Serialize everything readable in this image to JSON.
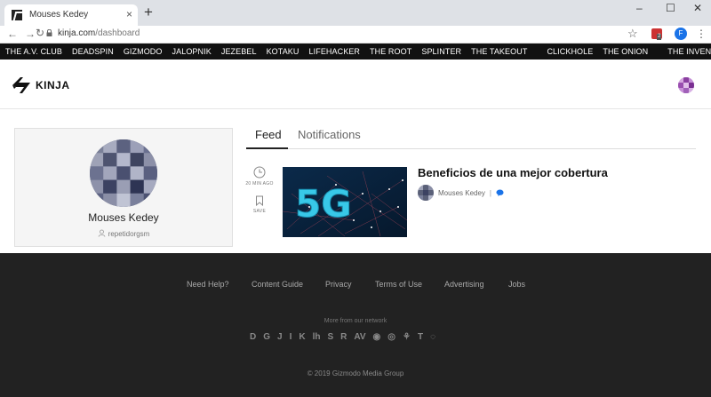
{
  "browser": {
    "tab_title": "Mouses Kedey",
    "tab_close": "×",
    "new_tab": "+",
    "window_controls": [
      "–",
      "☐",
      "✕"
    ],
    "url_host": "kinja.com",
    "url_path": "/dashboard",
    "back": "←",
    "forward": "→",
    "reload": "↻",
    "bookmark_star": "☆",
    "extension_badge": "2",
    "profile_initial": "F",
    "menu": "⋮"
  },
  "network_nav": {
    "group_sites": [
      "THE A.V. CLUB",
      "DEADSPIN",
      "GIZMODO",
      "JALOPNIK",
      "JEZEBEL",
      "KOTAKU",
      "LIFEHACKER",
      "THE ROOT",
      "SPLINTER",
      "THE TAKEOUT"
    ],
    "group_onion": [
      "CLICKHOLE",
      "THE ONION"
    ],
    "group_inventory": [
      "THE INVENTORY"
    ]
  },
  "header": {
    "logo_text": "KINJA"
  },
  "profile": {
    "name": "Mouses Kedey",
    "username": "repetidorgsm"
  },
  "feed_tabs": [
    {
      "label": "Feed",
      "active": true
    },
    {
      "label": "Notifications",
      "active": false
    }
  ],
  "post": {
    "time_ago": "20 MIN AGO",
    "save_label": "SAVE",
    "thumbnail_text": "5G",
    "title": "Beneficios de una mejor cobertura",
    "author": "Mouses Kedey",
    "separator": "|"
  },
  "footer": {
    "links": [
      "Need Help?",
      "Content Guide",
      "Privacy",
      "Terms of Use",
      "Advertising",
      "Jobs"
    ],
    "more_from_network": "More from our network",
    "brand_glyphs": [
      "D",
      "G",
      "J",
      "I",
      "K",
      "lh",
      "S",
      "R",
      "AV",
      "◉",
      "◎",
      "⚘",
      "T",
      "◌"
    ],
    "copyright": "© 2019 Gizmodo Media Group"
  },
  "colors": {
    "accent_blue": "#1a73e8",
    "network_bar": "#111111",
    "footer_bg": "#222222"
  }
}
